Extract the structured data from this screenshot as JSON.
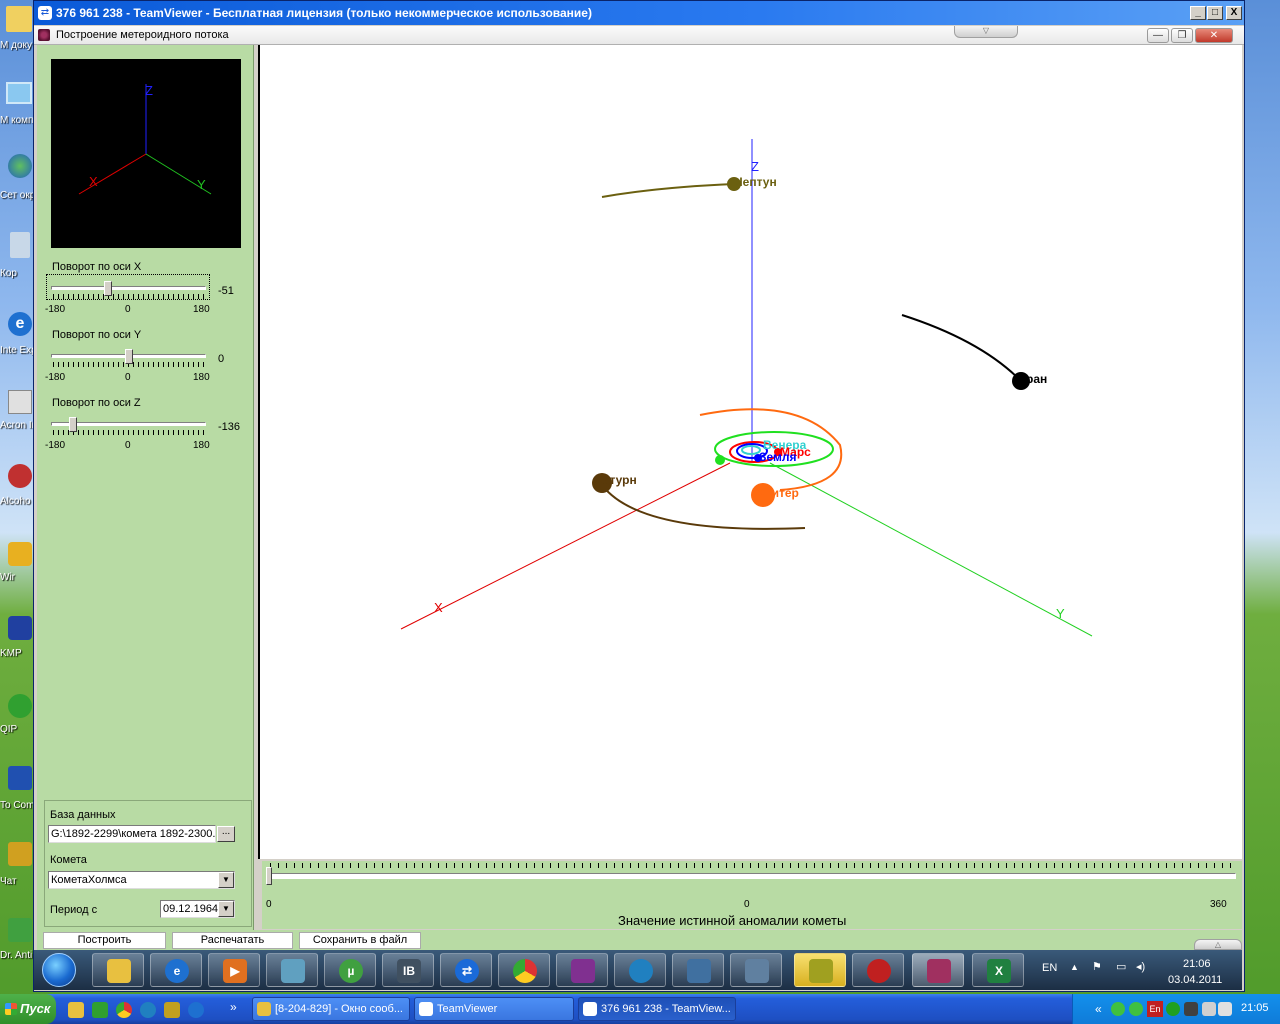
{
  "desktop": {
    "icon_labels": [
      "М доку",
      "М комп",
      "Сет окру",
      "Кор",
      "Inte Exp",
      "Acron Imag",
      "Alcoho",
      "Wir",
      "KMP",
      "QIP",
      "To Comm",
      "Чат",
      "Dr. Anti"
    ]
  },
  "teamviewer": {
    "title": "376 961 238 - TeamViewer - Бесплатная лицензия (только некоммерческое использование)",
    "controls": [
      "_",
      "□",
      "X"
    ]
  },
  "app": {
    "title": "Построение метероидного потока",
    "controls": [
      "—",
      "❐",
      "✕"
    ]
  },
  "axis_preview": {
    "x_label": "X",
    "y_label": "Y",
    "z_label": "Z"
  },
  "rotation": [
    {
      "label": "Поворот по оси X",
      "value": "-51",
      "min": "-180",
      "mid": "0",
      "max": "180",
      "fraction": 0.358
    },
    {
      "label": "Поворот по оси Y",
      "value": "0",
      "min": "-180",
      "mid": "0",
      "max": "180",
      "fraction": 0.5
    },
    {
      "label": "Поворот по оси Z",
      "value": "-136",
      "min": "-180",
      "mid": "0",
      "max": "180",
      "fraction": 0.122
    }
  ],
  "database": {
    "label": "База данных",
    "path": "G:\\1892-2299\\комета 1892-2300.0",
    "browse": "..."
  },
  "comet": {
    "label": "Комета",
    "value": "КометаХолмса"
  },
  "period": {
    "label": "Период с",
    "value": "09.12.1964"
  },
  "scene": {
    "axis_labels": {
      "x": "X",
      "y": "Y",
      "z": "Z"
    },
    "planets": {
      "neptune": "Нептун",
      "uranus": "Уран",
      "saturn": "Сатурн",
      "jupiter": "Юпитер",
      "venus": "Венера",
      "mars": "Марс",
      "earth": "Земля"
    },
    "colors": {
      "neptune": "#6b6010",
      "uranus": "#000000",
      "saturn": "#5a3a0a",
      "jupiter": "#ff6a10",
      "venus": "#30d0d0",
      "mars": "#ff0000",
      "earth": "#0000ff",
      "axis_x": "#e00000",
      "axis_y": "#20d020",
      "axis_z": "#2020ff",
      "comet_orbit": "#20e020"
    }
  },
  "anomaly": {
    "min": "0",
    "mid": "0",
    "max": "360",
    "caption": "Значение истинной аномалии кометы",
    "value": 0
  },
  "buttons": {
    "build": "Построить",
    "print": "Распечатать",
    "save": "Сохранить в файл"
  },
  "remote_tray": {
    "lang": "EN",
    "time": "21:06",
    "date": "03.04.2011"
  },
  "xp_taskbar": {
    "start": "Пуск",
    "more": "»",
    "tasks": [
      "[8-204-829] - Окно сооб...",
      "TeamViewer",
      "376 961 238 - TeamView..."
    ],
    "lang": "EN",
    "tray_lang": "En",
    "time": "21:05"
  }
}
